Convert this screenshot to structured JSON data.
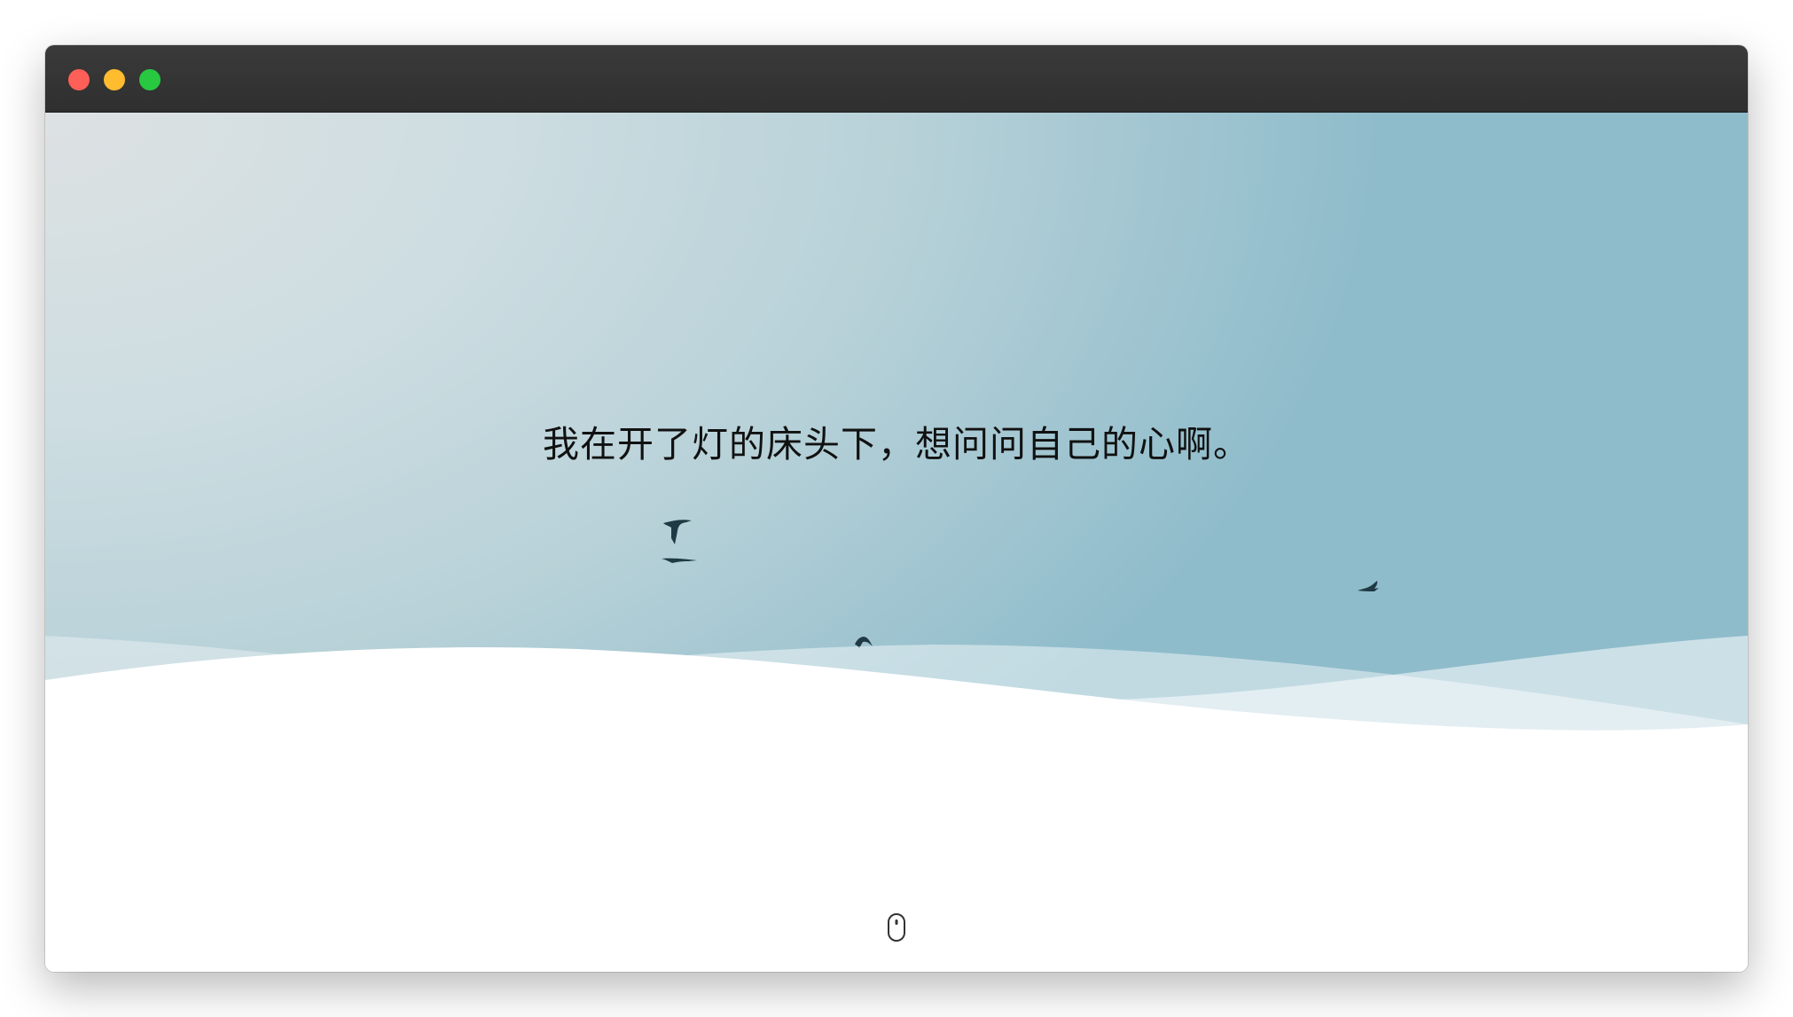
{
  "window": {
    "traffic_lights": {
      "close_color": "#fe5f57",
      "minimize_color": "#febc2e",
      "maximize_color": "#28c840"
    }
  },
  "hero": {
    "text": "我在开了灯的床头下，想问问自己的心啊。"
  },
  "scroll_hint": {
    "icon": "mouse-scroll-icon"
  },
  "colors": {
    "sky_light": "#dde1e3",
    "sky_dark": "#8fbccb",
    "bird": "#1f3a44"
  }
}
